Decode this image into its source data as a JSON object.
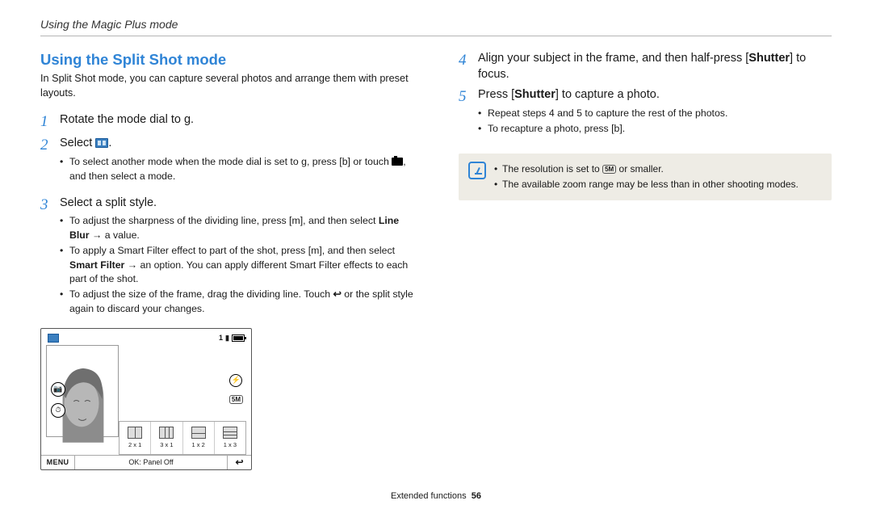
{
  "breadcrumb": "Using the Magic Plus mode",
  "section_title": "Using the Split Shot mode",
  "intro": "In Split Shot mode, you can capture several photos and arrange them with preset layouts.",
  "left_steps": {
    "s1": {
      "num": "1",
      "pre": "Rotate the mode dial to ",
      "glyph": "g",
      "post": "."
    },
    "s2": {
      "num": "2",
      "pre": "Select ",
      "sub1_pre": "To select another mode when the mode dial is set to ",
      "sub1_g1": "g",
      "sub1_mid": ", press [",
      "sub1_g2": "b",
      "sub1_mid2": "] or touch ",
      "sub1_post": ", and then select a mode."
    },
    "s3": {
      "num": "3",
      "text": "Select a split style.",
      "sub1_pre": "To adjust the sharpness of the dividing line, press [",
      "sub1_g": "m",
      "sub1_mid": "], and then select ",
      "sub1_bold": "Line Blur",
      "sub1_arrow": " → ",
      "sub1_post": "a value.",
      "sub2_pre": "To apply a Smart Filter effect to part of the shot, press [",
      "sub2_g": "m",
      "sub2_mid": "], and then select ",
      "sub2_bold": "Smart Filter",
      "sub2_arrow": " → ",
      "sub2_post": "an option. You can apply different Smart Filter effects to each part of the shot.",
      "sub3_pre": "To adjust the size of the frame, drag the dividing line. Touch ",
      "sub3_post": " or the split style again to discard your changes."
    }
  },
  "right_steps": {
    "s4": {
      "num": "4",
      "pre": "Align your subject in the frame, and then half-press [",
      "bold": "Shutter",
      "post": "] to focus."
    },
    "s5": {
      "num": "5",
      "pre": "Press [",
      "bold": "Shutter",
      "post": "] to capture a photo.",
      "sub1": "Repeat steps 4 and 5 to capture the rest of the photos.",
      "sub2_pre": "To recapture a photo, press [",
      "sub2_g": "b",
      "sub2_post": "]."
    }
  },
  "illus": {
    "count": "1",
    "styles": [
      {
        "cls": "p-2x1",
        "label": "2 x 1"
      },
      {
        "cls": "p-3x1",
        "label": "3 x 1"
      },
      {
        "cls": "p-1x2",
        "label": "1 x 2"
      },
      {
        "cls": "p-1x3",
        "label": "1 x 3"
      }
    ],
    "menu": "MENU",
    "ok": "OK: Panel Off",
    "undo": "↩"
  },
  "note": {
    "l1_pre": "The resolution is set to ",
    "l1_badge": "5M",
    "l1_post": " or smaller.",
    "l2": "The available zoom range may be less than in other shooting modes."
  },
  "footer": {
    "section": "Extended functions",
    "page": "56"
  }
}
